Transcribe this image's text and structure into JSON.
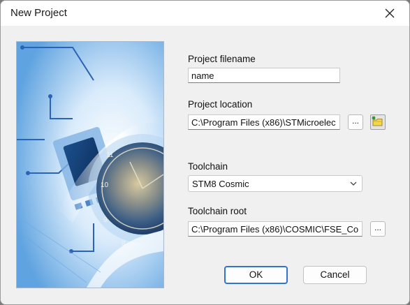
{
  "window": {
    "title": "New Project",
    "close_icon": "close-icon"
  },
  "form": {
    "filename_label": "Project filename",
    "filename_value": "name",
    "location_label": "Project location",
    "location_value": "C:\\Program Files (x86)\\STMicroelec",
    "location_browse_label": "...",
    "new_folder_icon": "new-folder-icon",
    "toolchain_label": "Toolchain",
    "toolchain_value": "STM8 Cosmic",
    "toolchain_root_label": "Toolchain root",
    "toolchain_root_value": "C:\\Program Files (x86)\\COSMIC\\FSE_Co",
    "toolchain_root_browse_label": "..."
  },
  "buttons": {
    "ok_label": "OK",
    "cancel_label": "Cancel"
  },
  "colors": {
    "default_button_border": "#2f74d0",
    "dialog_background": "#f0f0f0",
    "folder_icon": "#f5d84a"
  }
}
